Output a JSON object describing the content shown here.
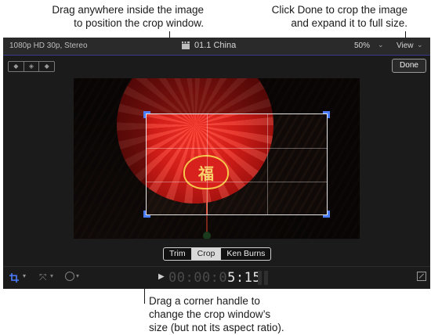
{
  "callouts": {
    "drag_crop_line1": "Drag anywhere inside the image",
    "drag_crop_line2": "to position the crop window.",
    "done_line1": "Click Done to crop the image",
    "done_line2": "and expand it to full size.",
    "corner_line1": "Drag a corner handle to",
    "corner_line2": "change the crop window’s",
    "corner_line3": "size (but not its aspect ratio)."
  },
  "viewer": {
    "format": "1080p HD 30p, Stereo",
    "clip_name": "01.1 China",
    "zoom": "50%",
    "view_menu": "View",
    "done_button": "Done",
    "keyframe_controls": [
      "◆",
      "◈",
      "◆"
    ],
    "image_glyph": "福"
  },
  "crop_modes": {
    "options": [
      "Trim",
      "Crop",
      "Ken Burns"
    ],
    "selected": "Crop"
  },
  "playback": {
    "timecode_dim": "00:00:0",
    "timecode_lit": "5:15"
  },
  "colors": {
    "handle_accent": "#4d7dff",
    "viewer_bg": "#1b1b1c"
  },
  "icons": [
    "clapper-icon",
    "crop-tool-icon",
    "transform-tool-icon",
    "speed-tool-icon",
    "play-icon",
    "fullscreen-icon",
    "chevron-down-icon"
  ]
}
